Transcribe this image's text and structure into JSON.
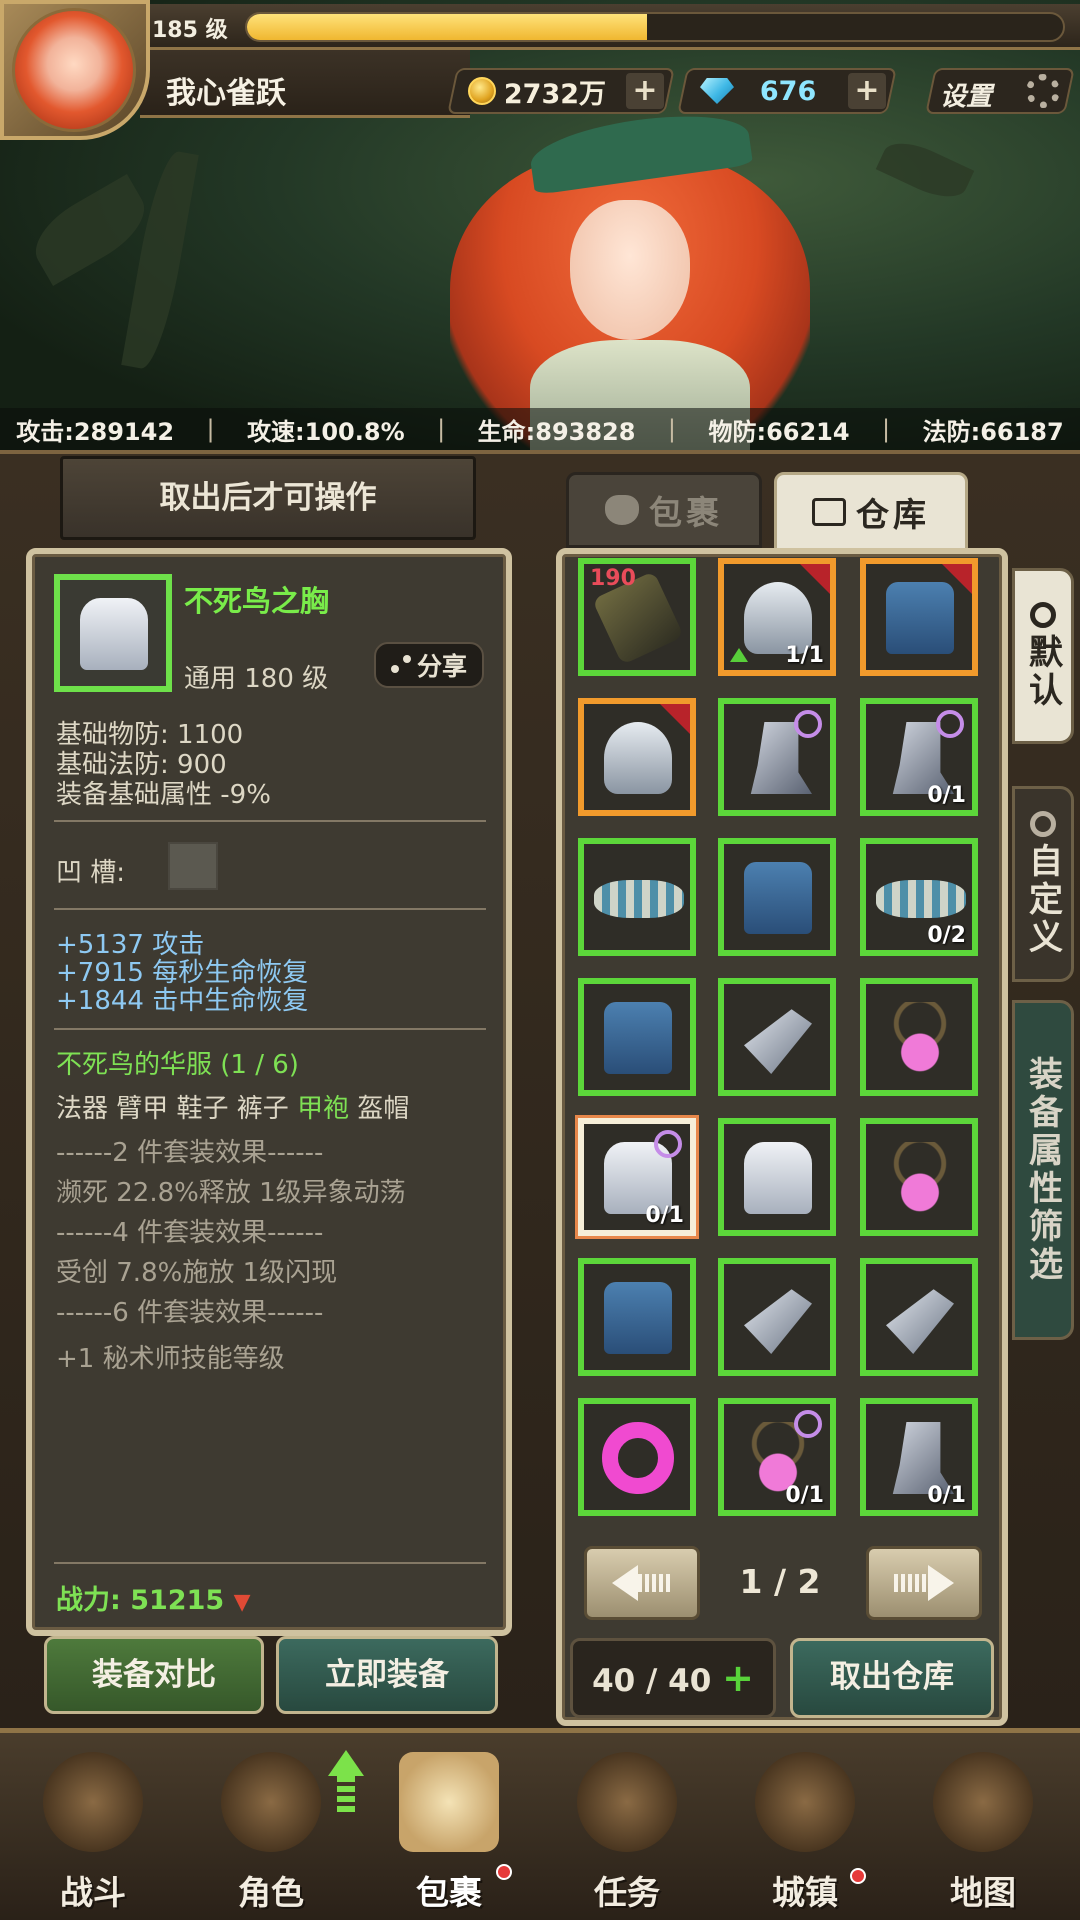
{
  "player": {
    "level": "185 级",
    "name": "我心雀跃",
    "xp_fraction": 0.49
  },
  "currency": {
    "gold": "2732万",
    "gems": "676",
    "plus": "+"
  },
  "settings_label": "设置",
  "stats": [
    "攻击:289142",
    "攻速:100.8%",
    "生命:893828",
    "物防:66214",
    "法防:66187"
  ],
  "left": {
    "header": "取出后才可操作",
    "item_name": "不死鸟之胸",
    "item_level": "通用 180 级",
    "share": "分享",
    "base_lines": [
      "基础物防:  1100",
      "基础法防:  900",
      "装备基础属性 -9%"
    ],
    "socket_label": "凹    槽:",
    "bonus_lines": [
      "+5137 攻击",
      "+7915 每秒生命恢复",
      "+1844 击中生命恢复"
    ],
    "set_title": "不死鸟的华服 (1 / 6)",
    "set_parts_prefix": "法器 臂甲 鞋子 裤子 ",
    "set_parts_active": "甲袍",
    "set_parts_suffix": " 盔帽",
    "set_effects": [
      "------2 件套装效果------",
      "濒死 22.8%释放 1级异象动荡",
      "------4 件套装效果------",
      "受创 7.8%施放 1级闪现",
      "------6 件套装效果------",
      "+1 秘术师技能等级"
    ],
    "power_label": "战力:",
    "power_value": "51215",
    "power_trend": "▼",
    "compare_btn": "装备对比",
    "equip_btn": "立即装备"
  },
  "right": {
    "tab_bag": "包裹",
    "tab_store": "仓库",
    "side_tabs": [
      "默认",
      "自定义",
      "装备属性筛选"
    ],
    "slots": [
      {
        "art": "scroll",
        "border": "green",
        "qty": "190"
      },
      {
        "art": "helm",
        "border": "orange",
        "count": "1/1",
        "corner": true,
        "up": true
      },
      {
        "art": "chest",
        "border": "orange",
        "corner": true
      },
      {
        "art": "helm",
        "border": "orange",
        "corner": true
      },
      {
        "art": "boot",
        "border": "green",
        "spiral": true
      },
      {
        "art": "boot",
        "border": "green",
        "spiral": true,
        "count": "0/1"
      },
      {
        "art": "belt",
        "border": "green"
      },
      {
        "art": "chest",
        "border": "green"
      },
      {
        "art": "belt",
        "border": "green",
        "count": "0/2"
      },
      {
        "art": "chest",
        "border": "green"
      },
      {
        "art": "wing",
        "border": "green"
      },
      {
        "art": "amulet",
        "border": "green"
      },
      {
        "art": "armor",
        "border": "sel",
        "spiral": true,
        "count": "0/1"
      },
      {
        "art": "armor",
        "border": "green"
      },
      {
        "art": "amulet",
        "border": "green"
      },
      {
        "art": "chest",
        "border": "green"
      },
      {
        "art": "wing",
        "border": "green"
      },
      {
        "art": "wing",
        "border": "green"
      },
      {
        "art": "ring",
        "border": "green"
      },
      {
        "art": "amulet",
        "border": "green",
        "spiral": true,
        "count": "0/1"
      },
      {
        "art": "boot",
        "border": "green",
        "count": "0/1"
      }
    ],
    "page": "1 / 2",
    "capacity": "40 / 40",
    "capacity_plus": "+",
    "withdraw_btn": "取出仓库"
  },
  "nav": [
    {
      "label": "战斗",
      "icon": "swords-shield-icon"
    },
    {
      "label": "角色",
      "icon": "helmet-icon"
    },
    {
      "label": "包裹",
      "icon": "backpack-icon"
    },
    {
      "label": "任务",
      "icon": "scroll-quill-icon"
    },
    {
      "label": "城镇",
      "icon": "tower-icon"
    },
    {
      "label": "地图",
      "icon": "map-icon"
    }
  ],
  "colors": {
    "rarity_green": "#5cd63a",
    "rarity_orange": "#f19a2c",
    "text_green": "#7ee154",
    "text_blue": "#8ec9f2"
  }
}
